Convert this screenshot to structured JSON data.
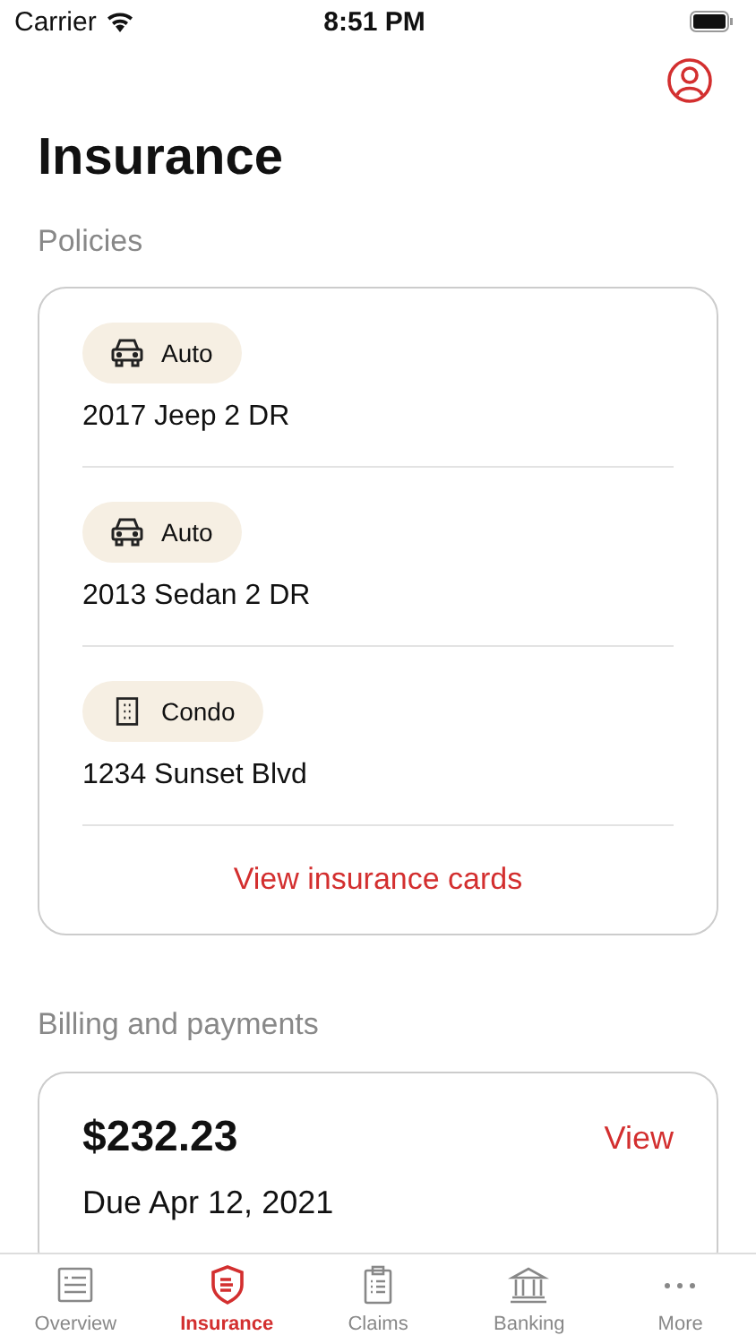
{
  "status_bar": {
    "carrier": "Carrier",
    "time": "8:51 PM"
  },
  "title": "Insurance",
  "policies": {
    "heading": "Policies",
    "items": [
      {
        "kind": "auto",
        "type_label": "Auto",
        "name": "2017 Jeep 2 DR"
      },
      {
        "kind": "auto",
        "type_label": "Auto",
        "name": "2013 Sedan 2 DR"
      },
      {
        "kind": "condo",
        "type_label": "Condo",
        "name": "1234 Sunset Blvd"
      }
    ],
    "link": "View insurance cards"
  },
  "billing": {
    "heading": "Billing and payments",
    "amount": "$232.23",
    "action": "View",
    "due": "Due Apr 12, 2021"
  },
  "tabs": [
    {
      "kind": "overview",
      "label": "Overview",
      "selected": false
    },
    {
      "kind": "insurance",
      "label": "Insurance",
      "selected": true
    },
    {
      "kind": "claims",
      "label": "Claims",
      "selected": false
    },
    {
      "kind": "banking",
      "label": "Banking",
      "selected": false
    },
    {
      "kind": "more",
      "label": "More",
      "selected": false
    }
  ]
}
